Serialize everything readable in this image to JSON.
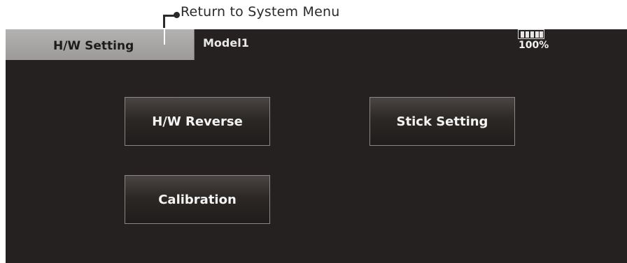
{
  "annotation": {
    "callout_text": "Return to System Menu"
  },
  "header": {
    "title": "H/W Setting",
    "model_name": "Model1",
    "battery": {
      "icon": "battery-icon",
      "level_fraction": 1.0,
      "percent_label": "100%"
    }
  },
  "menu": {
    "buttons": [
      {
        "label": "H/W Reverse"
      },
      {
        "label": "Stick Setting"
      },
      {
        "label": "Calibration"
      }
    ]
  },
  "colors": {
    "screen_background": "#252120",
    "title_tab": "#a8a6a4",
    "button_border": "#8a8886",
    "text_light": "#f4f4f4"
  }
}
